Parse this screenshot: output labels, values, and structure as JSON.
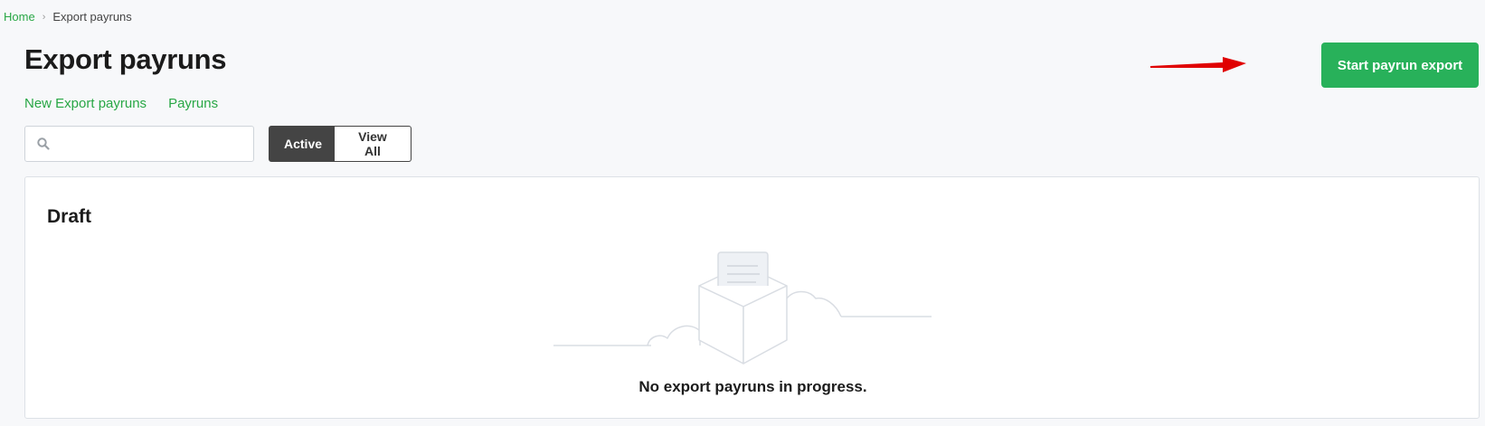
{
  "breadcrumb": {
    "home": "Home",
    "separator": "›",
    "current": "Export payruns"
  },
  "page": {
    "title": "Export payruns"
  },
  "subnav": {
    "new_export": "New Export payruns",
    "payruns": "Payruns"
  },
  "toolbar": {
    "start_export": "Start payrun export"
  },
  "search": {
    "placeholder": "",
    "value": ""
  },
  "filter": {
    "active_label": "Active",
    "view_all_label": "View All",
    "selected": "Active"
  },
  "draft": {
    "title": "Draft",
    "empty_message": "No export payruns in progress."
  },
  "colors": {
    "accent": "#28b15a",
    "link": "#28a745",
    "toggle_active": "#444444",
    "annotation_arrow": "#e00000"
  },
  "icons": {
    "search": "search-icon",
    "empty": "empty-box-document-icon",
    "arrow": "red-arrow-annotation"
  }
}
